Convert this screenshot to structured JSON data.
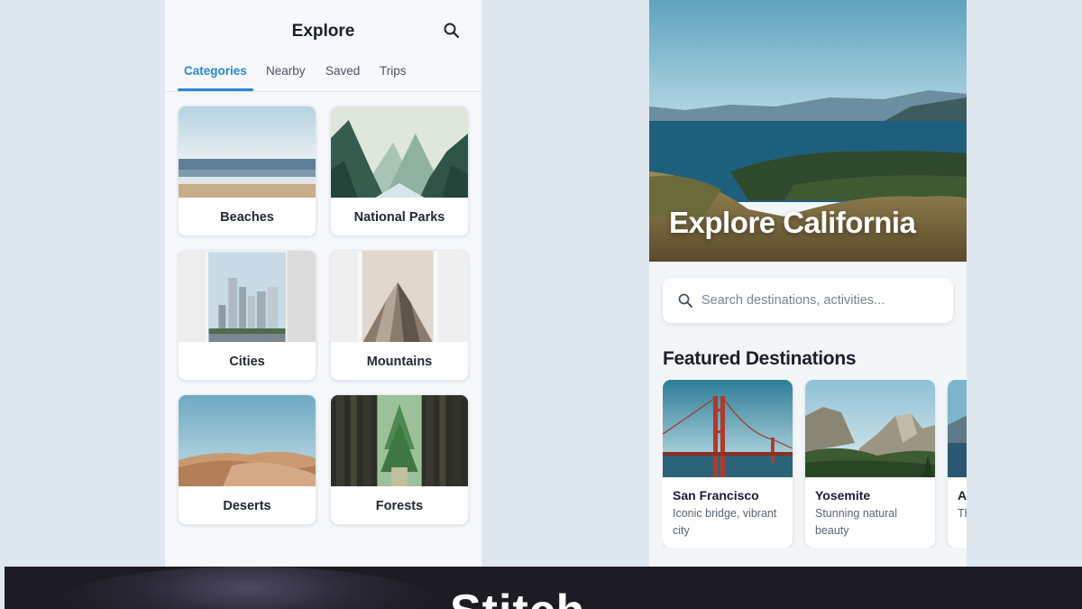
{
  "left_screen": {
    "title": "Explore",
    "tabs": [
      {
        "label": "Categories",
        "active": true
      },
      {
        "label": "Nearby",
        "active": false
      },
      {
        "label": "Saved",
        "active": false
      },
      {
        "label": "Trips",
        "active": false
      }
    ],
    "categories": [
      {
        "label": "Beaches"
      },
      {
        "label": "National Parks"
      },
      {
        "label": "Cities"
      },
      {
        "label": "Mountains"
      },
      {
        "label": "Deserts"
      },
      {
        "label": "Forests"
      }
    ]
  },
  "right_screen": {
    "hero_title": "Explore California",
    "search_placeholder": "Search destinations, activities...",
    "section_title": "Featured Destinations",
    "destinations": [
      {
        "name": "San Francisco",
        "description": "Iconic bridge, vibrant city"
      },
      {
        "name": "Yosemite",
        "description": "Stunning natural beauty"
      },
      {
        "name": "A",
        "description": "Th a"
      }
    ]
  },
  "banner": {
    "brand": "Stitch"
  },
  "colors": {
    "accent": "#2a86d6",
    "background": "#dfe8ee",
    "banner": "#1c1c22"
  }
}
